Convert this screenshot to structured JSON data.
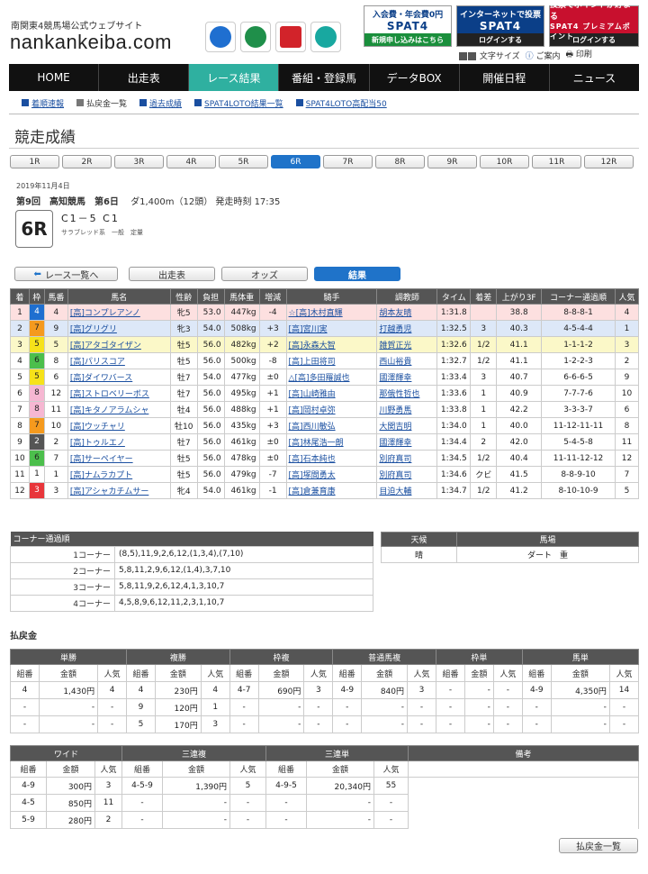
{
  "header": {
    "subtitle": "南関東4競馬場公式ウェブサイト",
    "logo": "nankankeiba.com",
    "banners": [
      {
        "top": "入会費・年会費0円",
        "logo": "SPAT4",
        "bottom": "新規申し込みはこちら",
        "color": "#1a8f3c"
      },
      {
        "top": "インターネットで投票",
        "logo": "SPAT4",
        "bottom": "ログインする",
        "color": "#0b3f88"
      },
      {
        "top": "投票でポイントが貯まる",
        "logo": "SPAT4 プレミアムポイント",
        "bottom": "ログインする",
        "color": "#c8102e"
      }
    ],
    "tools": {
      "font_size": "文字サイズ",
      "guide": "ご案内",
      "print": "印刷"
    }
  },
  "nav": {
    "items": [
      "HOME",
      "出走表",
      "レース結果",
      "番組・登録馬",
      "データBOX",
      "開催日程",
      "ニュース"
    ],
    "active_index": 2
  },
  "subnav": {
    "items": [
      {
        "label": "着順速報",
        "link": true
      },
      {
        "label": "払戻金一覧",
        "link": false
      },
      {
        "label": "過去成績",
        "link": true
      },
      {
        "label": "SPAT4LOTO結果一覧",
        "link": true
      },
      {
        "label": "SPAT4LOTO高配当50",
        "link": true
      }
    ]
  },
  "page_title": "競走成績",
  "race_tabs": {
    "items": [
      "1R",
      "2R",
      "3R",
      "4R",
      "5R",
      "6R",
      "7R",
      "8R",
      "9R",
      "10R",
      "11R",
      "12R"
    ],
    "active_index": 5
  },
  "race": {
    "date": "2019年11月4日",
    "meeting": "第9回　高知競馬　第6日",
    "distance": "ダ1,400m（12頭）",
    "post_time": "発走時刻 17:35",
    "number": "6R",
    "class": "C1－5 C1",
    "conditions": "サラブレッド系　一般　定量"
  },
  "buttons": {
    "back": "レース一覧へ",
    "entries": "出走表",
    "odds": "オッズ",
    "results": "結果",
    "payout_list": "払戻金一覧"
  },
  "results": {
    "headers": [
      "着",
      "枠",
      "馬番",
      "馬名",
      "性齢",
      "負担",
      "馬体重",
      "増減",
      "騎手",
      "調教師",
      "タイム",
      "着差",
      "上がり3F",
      "コーナー通過順",
      "人気"
    ],
    "rows": [
      [
        "1",
        "4",
        "4",
        "[高]コンプレアンノ",
        "牝5",
        "53.0",
        "447kg",
        "-4",
        "☆[高]木村直輝",
        "胡本友晴",
        "1:31.8",
        "",
        "38.8",
        "8-8-8-1",
        "4"
      ],
      [
        "2",
        "7",
        "9",
        "[高]グリグリ",
        "牝3",
        "54.0",
        "508kg",
        "+3",
        "[高]宮川実",
        "打越勇児",
        "1:32.5",
        "3",
        "40.3",
        "4-5-4-4",
        "1"
      ],
      [
        "3",
        "5",
        "5",
        "[高]アタゴタイザン",
        "牡5",
        "56.0",
        "482kg",
        "+2",
        "[高]永森大智",
        "雑賀正光",
        "1:32.6",
        "1/2",
        "41.1",
        "1-1-1-2",
        "3"
      ],
      [
        "4",
        "6",
        "8",
        "[高]パリスコア",
        "牡5",
        "56.0",
        "500kg",
        "-8",
        "[高]上田将司",
        "西山裕貴",
        "1:32.7",
        "1/2",
        "41.1",
        "1-2-2-3",
        "2"
      ],
      [
        "5",
        "5",
        "6",
        "[高]ダイワバース",
        "牡7",
        "54.0",
        "477kg",
        "±0",
        "△[高]多田羅誠也",
        "國澤輝幸",
        "1:33.4",
        "3",
        "40.7",
        "6-6-6-5",
        "9"
      ],
      [
        "6",
        "8",
        "12",
        "[高]ストロベリーボス",
        "牡7",
        "56.0",
        "495kg",
        "+1",
        "[高]山崎雅由",
        "那俄性哲也",
        "1:33.6",
        "1",
        "40.9",
        "7-7-7-6",
        "10"
      ],
      [
        "7",
        "8",
        "11",
        "[高]キタノアラムシャ",
        "牡4",
        "56.0",
        "488kg",
        "+1",
        "[高]岡村卓弥",
        "川野勇馬",
        "1:33.8",
        "1",
        "42.2",
        "3-3-3-7",
        "6"
      ],
      [
        "8",
        "7",
        "10",
        "[高]ウッチャリ",
        "牡10",
        "56.0",
        "435kg",
        "+3",
        "[高]西川敏弘",
        "大関吉明",
        "1:34.0",
        "1",
        "40.0",
        "11-12-11-11",
        "8"
      ],
      [
        "9",
        "2",
        "2",
        "[高]トゥルエノ",
        "牡7",
        "56.0",
        "461kg",
        "±0",
        "[高]林尾浩一朗",
        "國澤輝幸",
        "1:34.4",
        "2",
        "42.0",
        "5-4-5-8",
        "11"
      ],
      [
        "10",
        "6",
        "7",
        "[高]サーペイヤー",
        "牡5",
        "56.0",
        "478kg",
        "±0",
        "[高]石本純也",
        "別府真司",
        "1:34.5",
        "1/2",
        "40.4",
        "11-11-12-12",
        "12"
      ],
      [
        "11",
        "1",
        "1",
        "[高]ナムラカプト",
        "牡5",
        "56.0",
        "479kg",
        "-7",
        "[高]塚間勇太",
        "別府真司",
        "1:34.6",
        "クビ",
        "41.5",
        "8-8-9-10",
        "7"
      ],
      [
        "12",
        "3",
        "3",
        "[高]アシャカチムサー",
        "牝4",
        "54.0",
        "461kg",
        "-1",
        "[高]倉兼育康",
        "目迫大輔",
        "1:34.7",
        "1/2",
        "41.2",
        "8-10-10-9",
        "5"
      ]
    ]
  },
  "waku_colors": {
    "1": {
      "bg": "#ffffff",
      "fg": "#222222"
    },
    "2": {
      "bg": "#555555",
      "fg": "#ffffff"
    },
    "3": {
      "bg": "#e8363b",
      "fg": "#ffffff"
    },
    "4": {
      "bg": "#1f6fd0",
      "fg": "#ffffff"
    },
    "5": {
      "bg": "#f6e21a",
      "fg": "#222222"
    },
    "6": {
      "bg": "#4cbf4c",
      "fg": "#222222"
    },
    "7": {
      "bg": "#f59a1e",
      "fg": "#222222"
    },
    "8": {
      "bg": "#f6b7d2",
      "fg": "#222222"
    }
  },
  "corner": {
    "title": "コーナー通過順",
    "rows": [
      {
        "label": "1コーナー",
        "value": "(8,5),11,9,2,6,12,(1,3,4),(7,10)"
      },
      {
        "label": "2コーナー",
        "value": "5,8,11,2,9,6,12,(1,4),3,7,10"
      },
      {
        "label": "3コーナー",
        "value": "5,8,11,9,2,6,12,4,1,3,10,7"
      },
      {
        "label": "4コーナー",
        "value": "4,5,8,9,6,12,11,2,3,1,10,7"
      }
    ]
  },
  "conditions": {
    "headers": [
      "天候",
      "馬場"
    ],
    "weather": "晴",
    "track": "ダート　重"
  },
  "payout": {
    "title": "払戻金",
    "table1": {
      "groups": [
        "単勝",
        "複勝",
        "枠複",
        "普通馬複",
        "枠単",
        "馬単"
      ],
      "sub": [
        "組番",
        "金額",
        "人気"
      ],
      "rows": [
        [
          "4",
          "1,430円",
          "4",
          "4",
          "230円",
          "4",
          "4-7",
          "690円",
          "3",
          "4-9",
          "840円",
          "3",
          "-",
          "-",
          "-",
          "4-9",
          "4,350円",
          "14"
        ],
        [
          "-",
          "-",
          "-",
          "9",
          "120円",
          "1",
          "-",
          "-",
          "-",
          "-",
          "-",
          "-",
          "-",
          "-",
          "-",
          "-",
          "-",
          "-"
        ],
        [
          "-",
          "-",
          "-",
          "5",
          "170円",
          "3",
          "-",
          "-",
          "-",
          "-",
          "-",
          "-",
          "-",
          "-",
          "-",
          "-",
          "-",
          "-"
        ]
      ]
    },
    "table2": {
      "groups": [
        "ワイド",
        "三連複",
        "三連単",
        "備考"
      ],
      "sub": [
        "組番",
        "金額",
        "人気"
      ],
      "rows": [
        [
          "4-9",
          "300円",
          "3",
          "4-5-9",
          "1,390円",
          "5",
          "4-9-5",
          "20,340円",
          "55"
        ],
        [
          "4-5",
          "850円",
          "11",
          "-",
          "-",
          "-",
          "-",
          "-",
          "-"
        ],
        [
          "5-9",
          "280円",
          "2",
          "-",
          "-",
          "-",
          "-",
          "-",
          "-"
        ]
      ]
    }
  }
}
